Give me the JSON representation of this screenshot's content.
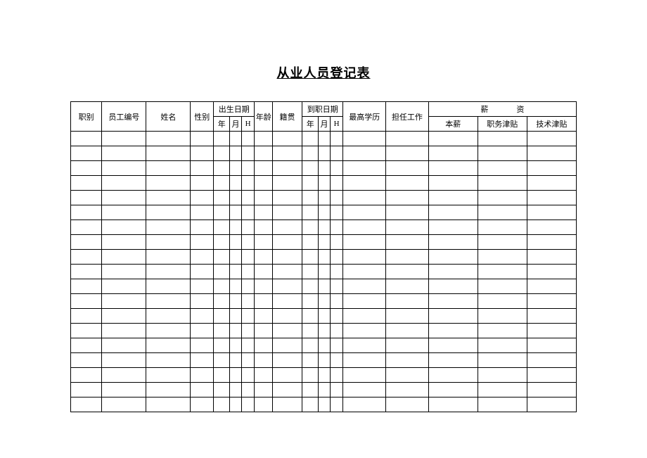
{
  "title": "从业人员登记表",
  "headers": {
    "position": "职别",
    "employee_id": "员工编号",
    "name": "姓名",
    "sex": "性别",
    "birth_date": "出生日期",
    "birth_year": "年",
    "birth_month": "月",
    "birth_day": "H",
    "age": "年龄",
    "origin": "籍贯",
    "hire_date": "到职日期",
    "hire_year": "年",
    "hire_month": "月",
    "hire_day": "H",
    "education": "最高学历",
    "job": "担任工作",
    "salary": "薪资",
    "salary_base": "本薪",
    "salary_position_allowance": "职务津贴",
    "salary_tech_allowance": "技术津贴"
  },
  "rows": [
    {},
    {},
    {},
    {},
    {},
    {},
    {},
    {},
    {},
    {},
    {},
    {},
    {},
    {},
    {},
    {},
    {},
    {},
    {}
  ]
}
